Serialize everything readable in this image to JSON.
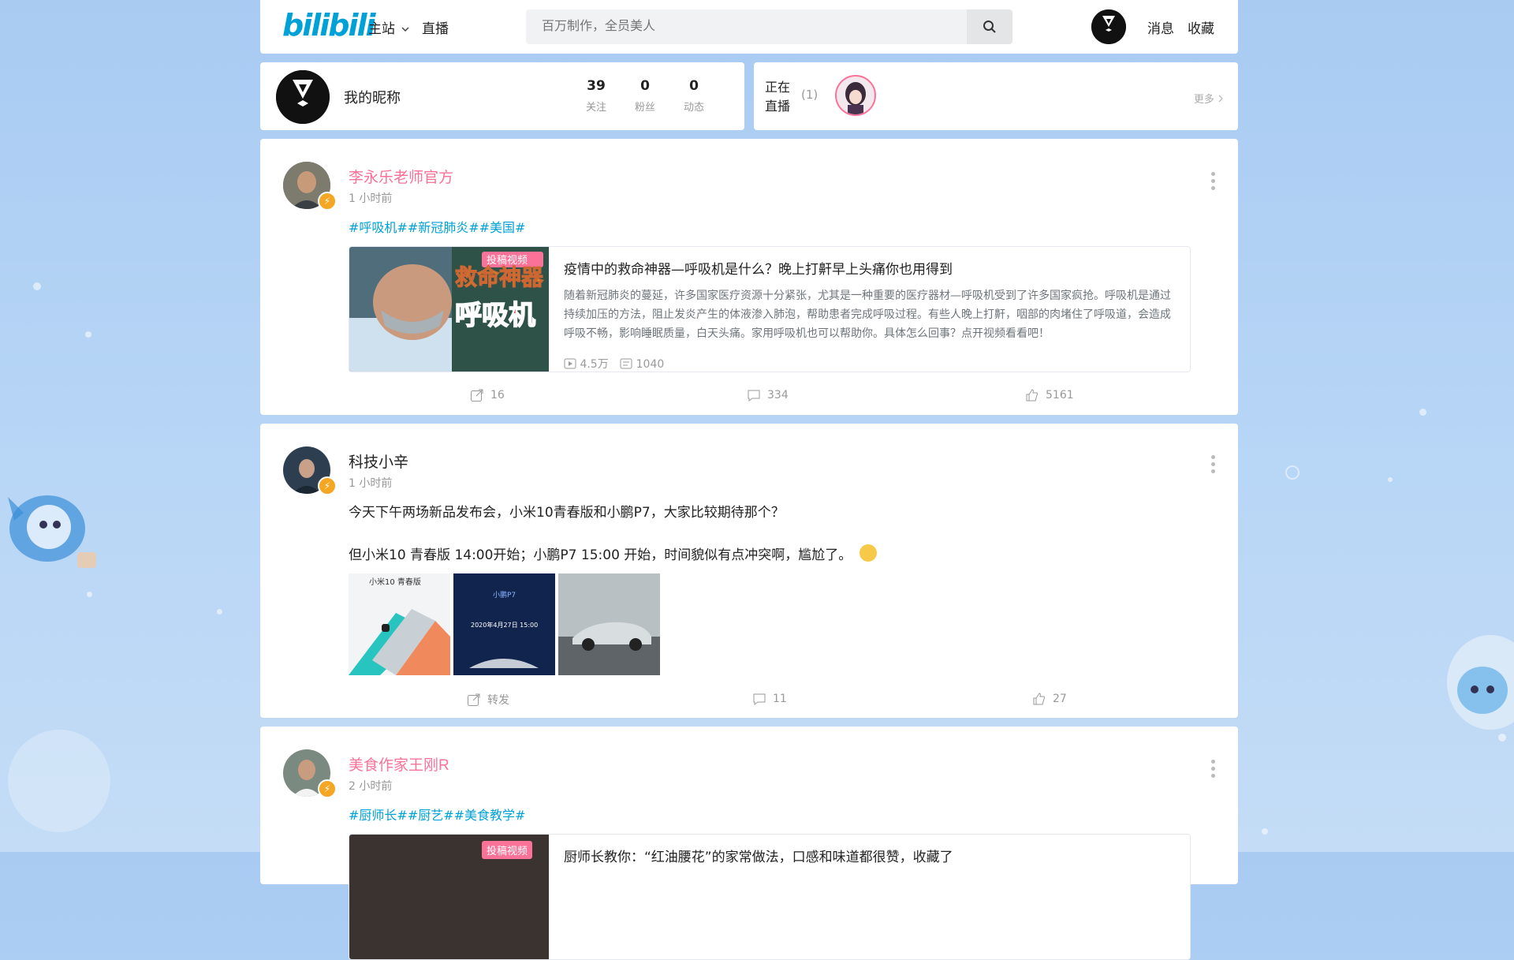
{
  "header": {
    "logo": "bilibili",
    "nav": [
      "主站",
      "直播"
    ],
    "search_placeholder": "百万制作，全员美人",
    "links": [
      "消息",
      "收藏"
    ]
  },
  "profile": {
    "name": "我的昵称",
    "stats": [
      {
        "num": "39",
        "label": "关注"
      },
      {
        "num": "0",
        "label": "粉丝"
      },
      {
        "num": "0",
        "label": "动态"
      }
    ]
  },
  "live": {
    "label_line1": "正在",
    "label_line2": "直播",
    "count": "(1)",
    "more": "更多"
  },
  "posts": [
    {
      "user": "李永乐老师官方",
      "time": "1 小时前",
      "tags": "#呼吸机##新冠肺炎##美国#",
      "video": {
        "badge": "投稿视频",
        "thumb_text_top": "救命神器",
        "thumb_text_main": "呼吸机",
        "title": "疫情中的救命神器—呼吸机是什么？晚上打鼾早上头痛你也用得到",
        "desc": "随着新冠肺炎的蔓延，许多国家医疗资源十分紧张，尤其是一种重要的医疗器材—呼吸机受到了许多国家疯抢。呼吸机是通过持续加压的方法，阻止发炎产生的体液渗入肺泡，帮助患者完成呼吸过程。有些人晚上打鼾，咽部的肉堵住了呼吸道，会造成呼吸不畅，影响睡眠质量，白天头痛。家用呼吸机也可以帮助你。具体怎么回事？点开视频看看吧！",
        "plays": "4.5万",
        "danmaku": "1040"
      },
      "share": "16",
      "comments": "334",
      "likes": "5161"
    },
    {
      "user": "科技小辛",
      "time": "1 小时前",
      "text1": "今天下午两场新品发布会，小米10青春版和小鹏P7，大家比较期待那个？",
      "text2": "但小米10 青春版 14:00开始；小鹏P7 15:00 开始，时间貌似有点冲突啊，尴尬了。",
      "img1_text": "小米10 青春版",
      "img2_text": "小鹏P7",
      "img2_date": "2020年4月27日 15:00",
      "share": "转发",
      "comments": "11",
      "likes": "27"
    },
    {
      "user": "美食作家王刚R",
      "time": "2 小时前",
      "tags": "#厨师长##厨艺##美食教学#",
      "video": {
        "badge": "投稿视频",
        "title": "厨师长教你：“红油腰花”的家常做法，口感和味道都很赞，收藏了"
      }
    }
  ],
  "colors": {
    "brand_blue": "#00a1d6",
    "pink": "#fb7299",
    "background": "#b3d2f5"
  }
}
